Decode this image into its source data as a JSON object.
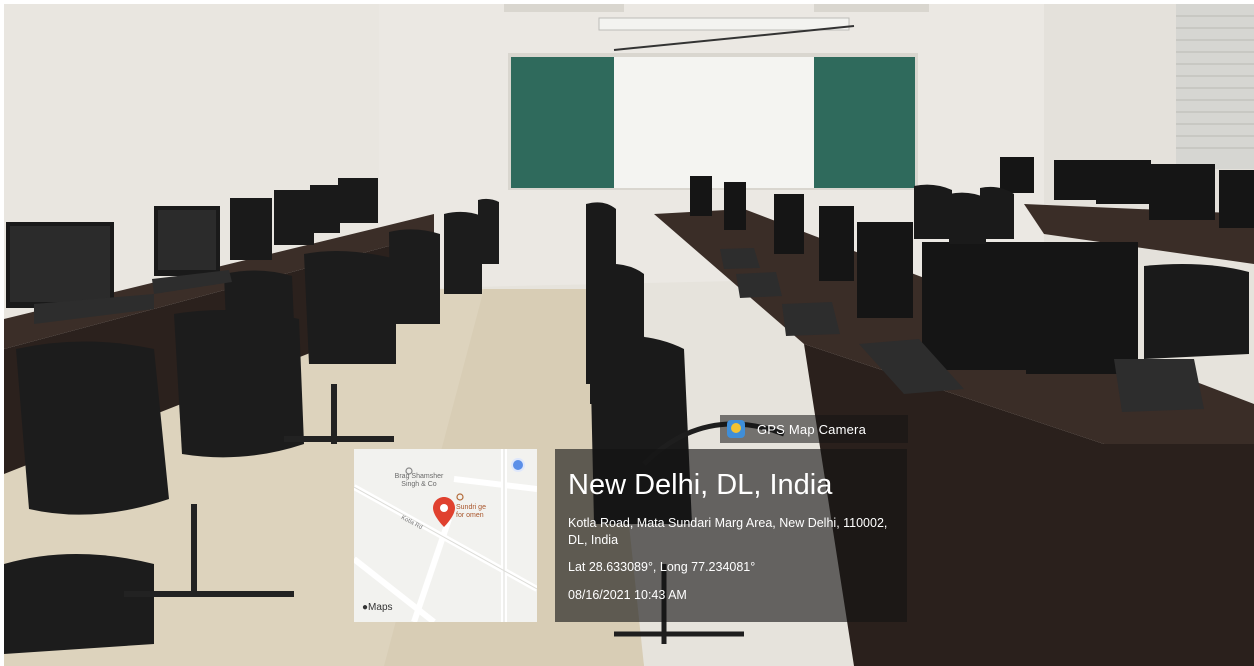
{
  "badge": {
    "label": "GPS Map Camera",
    "icon": "gps-map-camera-icon"
  },
  "location": {
    "city": "New Delhi, DL, India",
    "address": "Kotla Road, Mata Sundari Marg Area, New Delhi, 110002, DL, India",
    "coordinates": "Lat 28.633089°, Long 77.234081°",
    "datetime": "08/16/2021 10:43 AM"
  },
  "map": {
    "brand": "Maps",
    "poi_1": "Brag Shamsher Singh & Co",
    "poi_2": "Sundri ge for omen",
    "road": "Kotla Rd"
  },
  "colors": {
    "overlay": "#141414",
    "pin": "#e0412f",
    "accent": "#3f8ed8"
  }
}
